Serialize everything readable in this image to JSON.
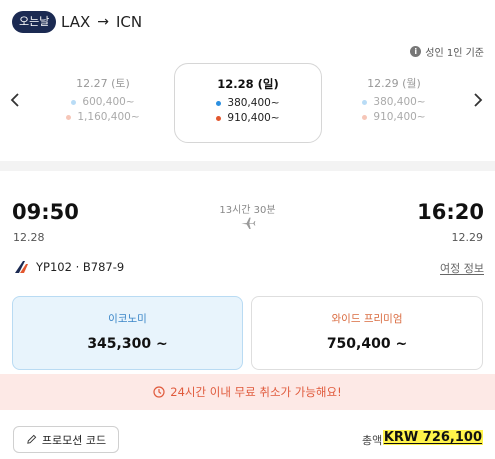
{
  "header": {
    "badge": "오는날",
    "origin": "LAX",
    "arrow": "→",
    "destination": "ICN"
  },
  "passenger_info": "성인 1인 기준",
  "date_options": [
    {
      "date": "12.27 (토)",
      "economy_fare": "600,400~",
      "premium_fare": "1,160,400~"
    },
    {
      "date": "12.28 (일)",
      "economy_fare": "380,400~",
      "premium_fare": "910,400~"
    },
    {
      "date": "12.29 (월)",
      "economy_fare": "380,400~",
      "premium_fare": "910,400~"
    }
  ],
  "colors": {
    "economy_dot": "#2b8fe0",
    "premium_dot": "#e2572e",
    "economy_dot_faded": "#b9dcf6",
    "premium_dot_faded": "#f6c6b8",
    "badge_bg": "#1b2a52",
    "notice_text": "#e05a3c",
    "highlight": "#fff34a"
  },
  "flight": {
    "departure_time": "09:50",
    "departure_date": "12.28",
    "duration": "13시간 30분",
    "arrival_time": "16:20",
    "arrival_date": "12.29",
    "flight_number": "YP102 · B787-9",
    "itinerary_link": "여정 정보"
  },
  "cabins": [
    {
      "name": "이코노미",
      "price": "345,300 ~"
    },
    {
      "name": "와이드 프리미엄",
      "price": "750,400 ~"
    }
  ],
  "notice": "24시간 이내 무료 취소가 가능해요!",
  "footer": {
    "promo_label": "프로모션 코드",
    "total_label": "총액",
    "total_value": "KRW 726,100"
  },
  "icons": {
    "info": "info-icon",
    "prev": "chevron-left-icon",
    "next": "chevron-right-icon",
    "plane": "plane-icon",
    "clock": "clock-icon",
    "pencil": "pencil-icon"
  }
}
